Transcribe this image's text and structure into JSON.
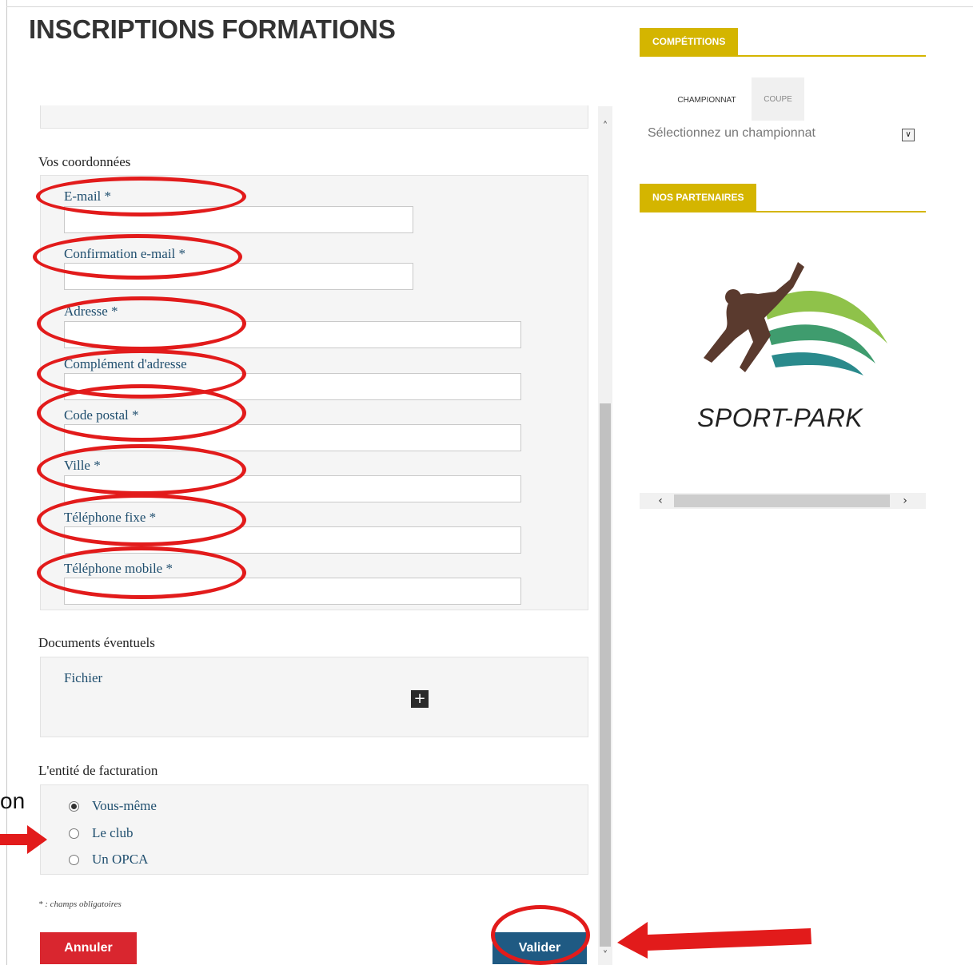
{
  "page": {
    "title": "INSCRIPTIONS FORMATIONS"
  },
  "form": {
    "contact": {
      "heading": "Vos coordonnées",
      "fields": [
        {
          "label": "E-mail *"
        },
        {
          "label": "Confirmation e-mail *"
        },
        {
          "label": "Adresse *"
        },
        {
          "label": "Complément d'adresse"
        },
        {
          "label": "Code postal *"
        },
        {
          "label": "Ville *"
        },
        {
          "label": "Téléphone fixe *"
        },
        {
          "label": "Téléphone mobile *"
        }
      ]
    },
    "documents": {
      "heading": "Documents éventuels",
      "file_label": "Fichier",
      "add_symbol": "+"
    },
    "billing": {
      "heading": "L'entité de facturation",
      "options": [
        {
          "label": "Vous-même",
          "selected": true
        },
        {
          "label": "Le club",
          "selected": false
        },
        {
          "label": "Un OPCA",
          "selected": false
        }
      ]
    },
    "required_note": "* : champs obligatoires",
    "cancel_label": "Annuler",
    "submit_label": "Valider"
  },
  "overlay": {
    "cut_text": "on"
  },
  "sidebar": {
    "competitions": {
      "header": "COMPÉTITIONS",
      "tabs": [
        "CHAMPIONNAT",
        "COUPE"
      ],
      "select_value": "Sélectionnez un championnat"
    },
    "partners": {
      "header": "NOS PARTENAIRES",
      "logo_text": "SPORT-PARK"
    }
  },
  "colors": {
    "brand_yellow": "#d4b500",
    "annotation_red": "#e21b1b",
    "cancel_red": "#d9262f",
    "submit_blue": "#1f5a83",
    "label_blue": "#1f4e6e"
  }
}
